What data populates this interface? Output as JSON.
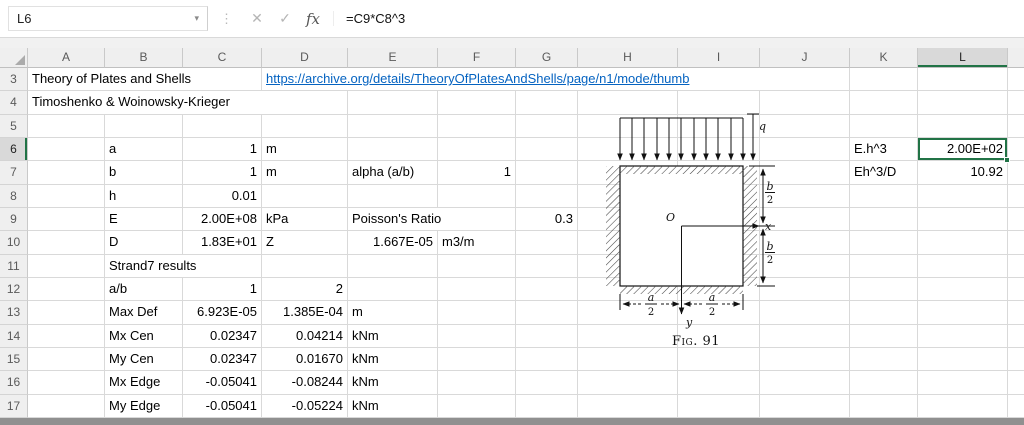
{
  "colors": {
    "accent_green": "#217346",
    "hyperlink_blue": "#0563c1"
  },
  "sheet": {
    "name_box": "L6",
    "formula": "=C9*C8^3",
    "fx_label": "fx",
    "selection": {
      "cell": "L6",
      "column": "L",
      "row": "6"
    },
    "columns": [
      "A",
      "B",
      "C",
      "D",
      "E",
      "F",
      "G",
      "H",
      "I",
      "J",
      "K",
      "L"
    ],
    "rows": [
      {
        "n": "3",
        "cells": [
          {
            "c": "A",
            "span": 3,
            "t": "Theory of Plates and Shells"
          },
          {
            "c": "D",
            "span": 7,
            "t": "https://archive.org/details/TheoryOfPlatesAndShells/page/n1/mode/thumb",
            "link": true
          }
        ]
      },
      {
        "n": "4",
        "cells": [
          {
            "c": "A",
            "span": 4,
            "t": "Timoshenko & Woinowsky-Krieger"
          }
        ]
      },
      {
        "n": "5",
        "cells": []
      },
      {
        "n": "6",
        "cells": [
          {
            "c": "B",
            "t": "a"
          },
          {
            "c": "C",
            "t": "1",
            "r": true
          },
          {
            "c": "D",
            "t": "m"
          },
          {
            "c": "K",
            "t": "E.h^3"
          },
          {
            "c": "L",
            "t": "2.00E+02",
            "r": true,
            "sel": true
          }
        ]
      },
      {
        "n": "7",
        "cells": [
          {
            "c": "B",
            "t": "b"
          },
          {
            "c": "C",
            "t": "1",
            "r": true
          },
          {
            "c": "D",
            "t": "m"
          },
          {
            "c": "E",
            "t": "alpha (a/b)"
          },
          {
            "c": "F",
            "t": "1",
            "r": true
          },
          {
            "c": "K",
            "t": "Eh^3/D"
          },
          {
            "c": "L",
            "t": "10.92",
            "r": true
          }
        ]
      },
      {
        "n": "8",
        "cells": [
          {
            "c": "B",
            "t": "h"
          },
          {
            "c": "C",
            "t": "0.01",
            "r": true
          }
        ]
      },
      {
        "n": "9",
        "cells": [
          {
            "c": "B",
            "t": "E"
          },
          {
            "c": "C",
            "t": "2.00E+08",
            "r": true
          },
          {
            "c": "D",
            "t": "kPa"
          },
          {
            "c": "E",
            "span": 2,
            "t": "Poisson's Ratio"
          },
          {
            "c": "G",
            "t": "0.3",
            "r": true
          }
        ]
      },
      {
        "n": "10",
        "cells": [
          {
            "c": "B",
            "t": "D"
          },
          {
            "c": "C",
            "t": "1.83E+01",
            "r": true
          },
          {
            "c": "D",
            "t": "Z"
          },
          {
            "c": "E",
            "t": "1.667E-05",
            "r": true
          },
          {
            "c": "F",
            "t": "m3/m"
          }
        ]
      },
      {
        "n": "11",
        "cells": [
          {
            "c": "B",
            "span": 2,
            "t": "Strand7 results"
          }
        ]
      },
      {
        "n": "12",
        "cells": [
          {
            "c": "B",
            "t": "a/b"
          },
          {
            "c": "C",
            "t": "1",
            "r": true
          },
          {
            "c": "D",
            "t": "2",
            "r": true
          }
        ]
      },
      {
        "n": "13",
        "cells": [
          {
            "c": "B",
            "t": "Max Def"
          },
          {
            "c": "C",
            "t": "6.923E-05",
            "r": true
          },
          {
            "c": "D",
            "t": "1.385E-04",
            "r": true
          },
          {
            "c": "E",
            "t": "m"
          }
        ]
      },
      {
        "n": "14",
        "cells": [
          {
            "c": "B",
            "t": "Mx Cen"
          },
          {
            "c": "C",
            "t": "0.02347",
            "r": true
          },
          {
            "c": "D",
            "t": "0.04214",
            "r": true
          },
          {
            "c": "E",
            "t": "kNm"
          }
        ]
      },
      {
        "n": "15",
        "cells": [
          {
            "c": "B",
            "t": "My Cen"
          },
          {
            "c": "C",
            "t": "0.02347",
            "r": true
          },
          {
            "c": "D",
            "t": "0.01670",
            "r": true
          },
          {
            "c": "E",
            "t": "kNm"
          }
        ]
      },
      {
        "n": "16",
        "cells": [
          {
            "c": "B",
            "t": "Mx Edge"
          },
          {
            "c": "C",
            "t": "-0.05041",
            "r": true
          },
          {
            "c": "D",
            "t": "-0.08244",
            "r": true
          },
          {
            "c": "E",
            "t": "kNm"
          }
        ]
      },
      {
        "n": "17",
        "cells": [
          {
            "c": "B",
            "t": "My Edge"
          },
          {
            "c": "C",
            "t": "-0.05041",
            "r": true
          },
          {
            "c": "D",
            "t": "-0.05224",
            "r": true
          },
          {
            "c": "E",
            "t": "kNm"
          }
        ]
      }
    ]
  },
  "figure": {
    "load_label": "q",
    "origin_label": "O",
    "x_axis_label": "x",
    "y_axis_label": "y",
    "dim_b_upper": {
      "num": "b",
      "den": "2"
    },
    "dim_b_lower": {
      "num": "b",
      "den": "2"
    },
    "dim_a_left": {
      "num": "a",
      "den": "2"
    },
    "dim_a_right": {
      "num": "a",
      "den": "2"
    },
    "caption": "Fig. 91"
  }
}
